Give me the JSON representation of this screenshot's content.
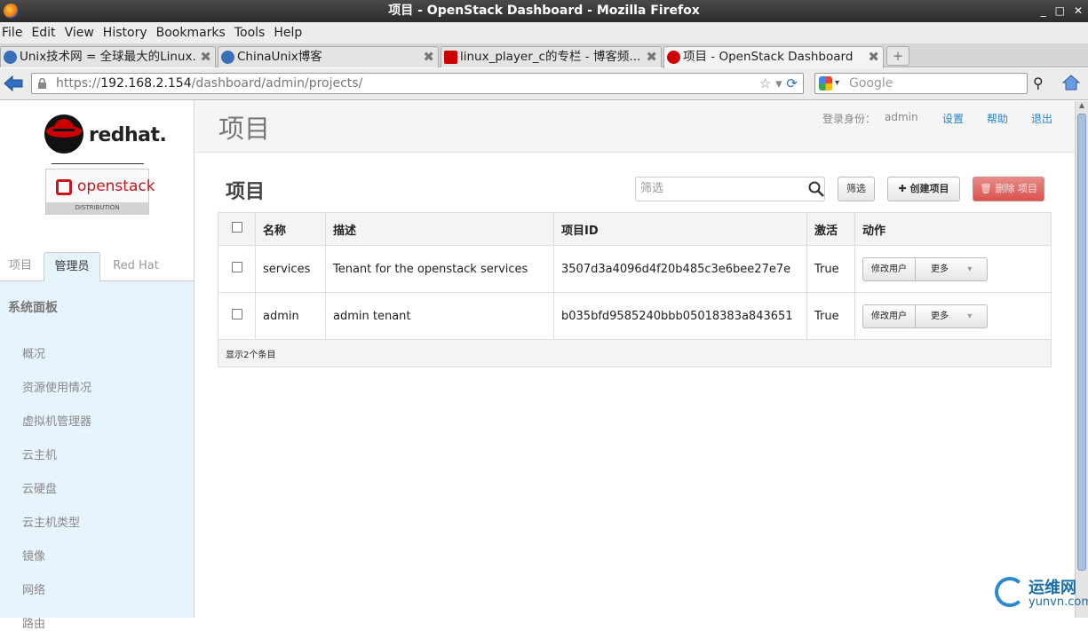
{
  "window": {
    "title": "项目 - OpenStack Dashboard - Mozilla Firefox"
  },
  "menu": [
    "File",
    "Edit",
    "View",
    "History",
    "Bookmarks",
    "Tools",
    "Help"
  ],
  "tabs": [
    {
      "label": "Unix技术网 = 全球最大的Linux...",
      "active": false
    },
    {
      "label": "ChinaUnix博客",
      "active": false
    },
    {
      "label": "linux_player_c的专栏 - 博客频...",
      "active": false
    },
    {
      "label": "项目 - OpenStack Dashboard",
      "active": true
    }
  ],
  "nav": {
    "url_prefix": "https://",
    "url_host": "192.168.2.154",
    "url_path": "/dashboard/admin/projects/",
    "search_placeholder": "Google"
  },
  "sidebar": {
    "brand": "redhat.",
    "product": "openstack",
    "distribution": "DISTRIBUTION",
    "tabs": [
      "项目",
      "管理员",
      "Red Hat"
    ],
    "panel_title": "系统面板",
    "items": [
      "概况",
      "资源使用情况",
      "虚拟机管理器",
      "云主机",
      "云硬盘",
      "云主机类型",
      "镜像",
      "网络",
      "路由"
    ]
  },
  "header": {
    "title": "项目",
    "login_label": "登录身份：",
    "user": "admin",
    "settings": "设置",
    "help": "帮助",
    "logout": "退出"
  },
  "content": {
    "section_title": "项目",
    "filter_placeholder": "筛选",
    "filter_button": "筛选",
    "create_button": "创建项目",
    "delete_button": "删除 项目",
    "columns": [
      "名称",
      "描述",
      "项目ID",
      "激活",
      "动作"
    ],
    "rows": [
      {
        "name": "services",
        "desc": "Tenant for the openstack services",
        "id": "3507d3a4096d4f20b485c3e6bee27e7e",
        "enabled": "True",
        "action": "修改用户",
        "more": "更多"
      },
      {
        "name": "admin",
        "desc": "admin tenant",
        "id": "b035bfd9585240bbb05018383a843651",
        "enabled": "True",
        "action": "修改用户",
        "more": "更多"
      }
    ],
    "footer": "显示2个条目"
  },
  "watermark": {
    "cn": "运维网",
    "en": "yunvn.com"
  },
  "colors": {
    "accent": "#2a84c9",
    "danger": "#d9534f",
    "panel_bg": "#e8f4fc"
  }
}
